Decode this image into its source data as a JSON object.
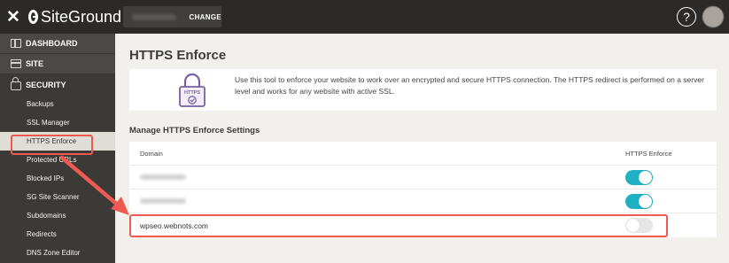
{
  "topbar": {
    "close_icon": "close-icon",
    "logo_text": "SiteGround",
    "site_selector": {
      "change_label": "CHANGE"
    },
    "help_label": "?"
  },
  "sidebar": {
    "sections": [
      {
        "label": "DASHBOARD",
        "icon": "dashboard-icon"
      },
      {
        "label": "SITE",
        "icon": "site-icon"
      },
      {
        "label": "SECURITY",
        "icon": "lock-icon"
      }
    ],
    "items": [
      {
        "label": "Backups"
      },
      {
        "label": "SSL Manager"
      },
      {
        "label": "HTTPS Enforce",
        "active": true
      },
      {
        "label": "Protected URLs"
      },
      {
        "label": "Blocked IPs"
      },
      {
        "label": "SG Site Scanner"
      },
      {
        "label": "Subdomains"
      },
      {
        "label": "Redirects"
      },
      {
        "label": "DNS Zone Editor"
      }
    ]
  },
  "main": {
    "title": "HTTPS Enforce",
    "info": {
      "icon_label": "HTTPS",
      "text": "Use this tool to enforce your website to work over an encrypted and secure HTTPS connection. The HTTPS redirect is performed on a server level and works for any website with active SSL."
    },
    "section_title": "Manage HTTPS Enforce Settings",
    "table": {
      "headers": [
        "Domain",
        "HTTPS Enforce"
      ],
      "rows": [
        {
          "domain": "",
          "enforced": true
        },
        {
          "domain": "",
          "enforced": true
        },
        {
          "domain": "wpseo.webnots.com",
          "enforced": false
        }
      ]
    }
  },
  "colors": {
    "accent": "#1fb0c4",
    "highlight": "#ef5a50",
    "topbar": "#2b2a28",
    "sidebar": "#3b3a37"
  }
}
